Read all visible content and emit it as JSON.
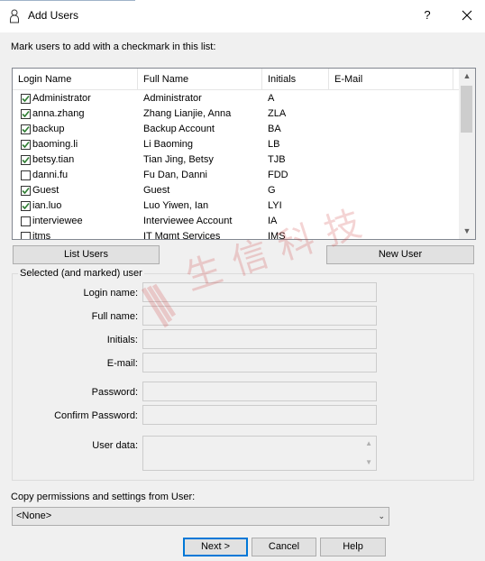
{
  "window": {
    "title": "Add Users",
    "help": "?",
    "close": "✕"
  },
  "instruction": "Mark users to add with a checkmark in this list:",
  "list": {
    "columns": [
      "Login Name",
      "Full Name",
      "Initials",
      "E-Mail"
    ],
    "rows": [
      {
        "checked": true,
        "login": "Administrator",
        "full": "Administrator",
        "initials": "A",
        "email": ""
      },
      {
        "checked": true,
        "login": "anna.zhang",
        "full": "Zhang Lianjie, Anna",
        "initials": "ZLA",
        "email": ""
      },
      {
        "checked": true,
        "login": "backup",
        "full": "Backup Account",
        "initials": "BA",
        "email": ""
      },
      {
        "checked": true,
        "login": "baoming.li",
        "full": "Li Baoming",
        "initials": "LB",
        "email": ""
      },
      {
        "checked": true,
        "login": "betsy.tian",
        "full": "Tian Jing, Betsy",
        "initials": "TJB",
        "email": ""
      },
      {
        "checked": false,
        "login": "danni.fu",
        "full": "Fu Dan, Danni",
        "initials": "FDD",
        "email": ""
      },
      {
        "checked": true,
        "login": "Guest",
        "full": "Guest",
        "initials": "G",
        "email": ""
      },
      {
        "checked": true,
        "login": "ian.luo",
        "full": "Luo Yiwen, Ian",
        "initials": "LYI",
        "email": ""
      },
      {
        "checked": false,
        "login": "interviewee",
        "full": "Interviewee Account",
        "initials": "IA",
        "email": ""
      },
      {
        "checked": false,
        "login": "itms",
        "full": "IT Mgmt Services",
        "initials": "IMS",
        "email": ""
      }
    ],
    "scroll_up": "▲",
    "scroll_down": "▼"
  },
  "buttons": {
    "list_users": "List Users",
    "new_user": "New User",
    "next": "Next >",
    "cancel": "Cancel",
    "help": "Help"
  },
  "selected": {
    "legend": "Selected (and marked) user",
    "login_name": "Login name:",
    "full_name": "Full name:",
    "initials": "Initials:",
    "email": "E-mail:",
    "password": "Password:",
    "confirm_password": "Confirm Password:",
    "user_data": "User data:",
    "login_name_value": "",
    "full_name_value": "",
    "initials_value": "",
    "email_value": "",
    "password_value": "",
    "confirm_password_value": "",
    "user_data_value": ""
  },
  "copy": {
    "label": "Copy permissions and settings from User:",
    "selected": "<None>",
    "arrow": "⌄"
  },
  "watermark": {
    "text": "生信科技"
  },
  "colors": {
    "accent": "#0078d7",
    "check": "#2e7d32",
    "watermark": "#d04040"
  }
}
